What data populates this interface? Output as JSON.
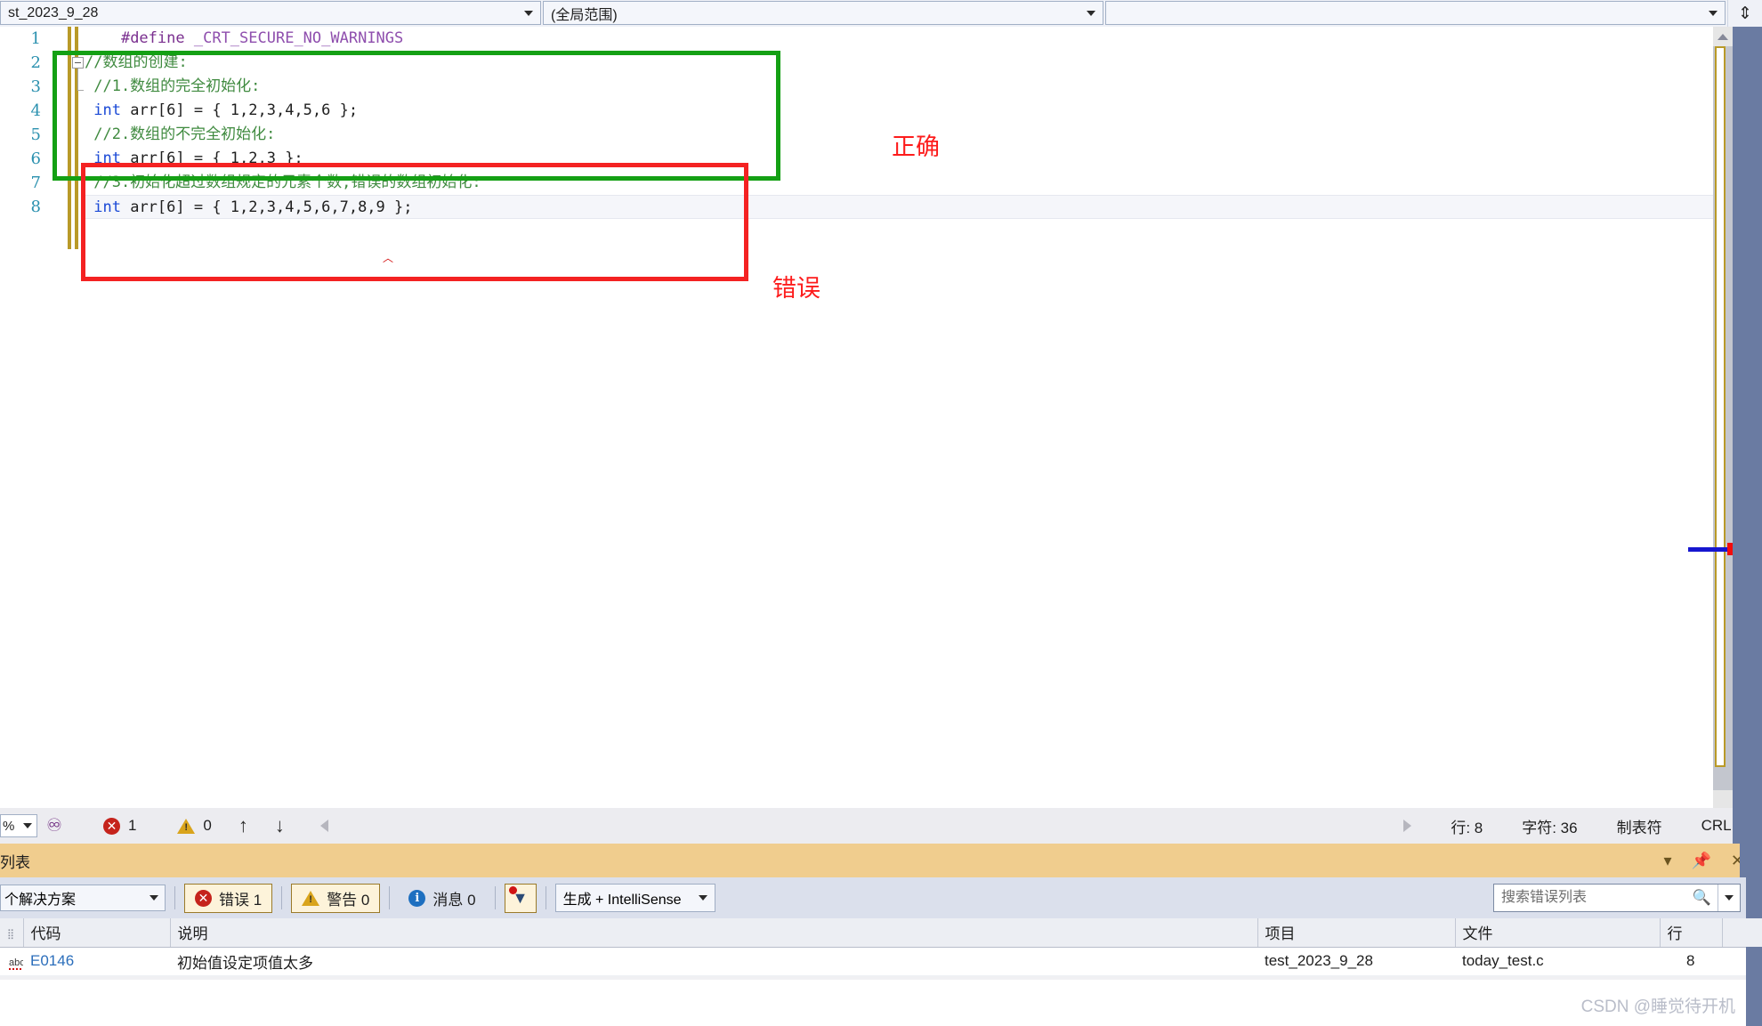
{
  "navbar": {
    "project_combo": "st_2023_9_28",
    "scope_combo": "(全局范围)",
    "function_combo": "",
    "split_icon": "split-window-icon"
  },
  "editor": {
    "line_numbers": [
      "1",
      "2",
      "3",
      "4",
      "5",
      "6",
      "7",
      "8"
    ],
    "lines": [
      {
        "n": "1",
        "segments": [
          {
            "t": "    ",
            "c": "plain"
          },
          {
            "t": "#define",
            "c": "pp"
          },
          {
            "t": " ",
            "c": "plain"
          },
          {
            "t": "_CRT_SECURE_NO_WARNINGS",
            "c": "macro"
          }
        ]
      },
      {
        "n": "2",
        "segments": [
          {
            "t": "//数组的创建:",
            "c": "comment"
          }
        ]
      },
      {
        "n": "3",
        "segments": [
          {
            "t": " //1.数组的完全初始化:",
            "c": "comment"
          }
        ]
      },
      {
        "n": "4",
        "segments": [
          {
            "t": " ",
            "c": "plain"
          },
          {
            "t": "int",
            "c": "kw"
          },
          {
            "t": " arr[6] = { 1,2,3,4,5,6 };",
            "c": "plain"
          }
        ]
      },
      {
        "n": "5",
        "segments": [
          {
            "t": " //2.数组的不完全初始化:",
            "c": "comment"
          }
        ]
      },
      {
        "n": "6",
        "segments": [
          {
            "t": " ",
            "c": "plain"
          },
          {
            "t": "int",
            "c": "kw"
          },
          {
            "t": " arr[6] = { 1,2,3 };",
            "c": "plain"
          }
        ]
      },
      {
        "n": "7",
        "segments": [
          {
            "t": " //3.初始化超过数组规定的元素个数,错误的数组初始化:",
            "c": "comment"
          }
        ]
      },
      {
        "n": "8",
        "segments": [
          {
            "t": " ",
            "c": "plain"
          },
          {
            "t": "int",
            "c": "kw"
          },
          {
            "t": " arr[6] = { 1,2,3,4,5,6,7,8,9 };",
            "c": "plain"
          }
        ]
      }
    ]
  },
  "annotations": {
    "correct_label": "正确",
    "error_label": "错误",
    "correct_color": "#14a014",
    "error_color": "#f42222"
  },
  "editor_status": {
    "zoom_value": "%",
    "intellisense_icon": "intellisense-icon",
    "error_icon": "error-circle-icon",
    "error_count": "1",
    "warning_icon": "warning-triangle-icon",
    "warning_count": "0",
    "prev_icon": "↑",
    "next_icon": "↓",
    "line_label": "行: 8",
    "char_label": "字符: 36",
    "tab_label": "制表符",
    "eol_label": "CRLF"
  },
  "panel": {
    "title": "列表",
    "title_buttons": [
      "dropdown-icon",
      "pin-icon",
      "close-icon"
    ],
    "toolbar": {
      "scope_combo": "个解决方案",
      "errors_label": "错误 1",
      "warnings_label": "警告 0",
      "messages_label": "消息 0",
      "filter_icon": "filter-icon",
      "build_combo": "生成 + IntelliSense",
      "search_placeholder": "搜索错误列表",
      "search_value": "",
      "search_icon": "search-icon"
    },
    "table": {
      "headers": [
        "",
        "代码",
        "说明",
        "项目",
        "文件",
        "行",
        ""
      ],
      "rows": [
        {
          "severity_icon": "abc-spellcheck-icon",
          "code": "E0146",
          "description": "初始值设定项值太多",
          "project": "test_2023_9_28",
          "file": "today_test.c",
          "line": "8"
        }
      ]
    }
  },
  "watermark": "CSDN @睡觉待开机"
}
